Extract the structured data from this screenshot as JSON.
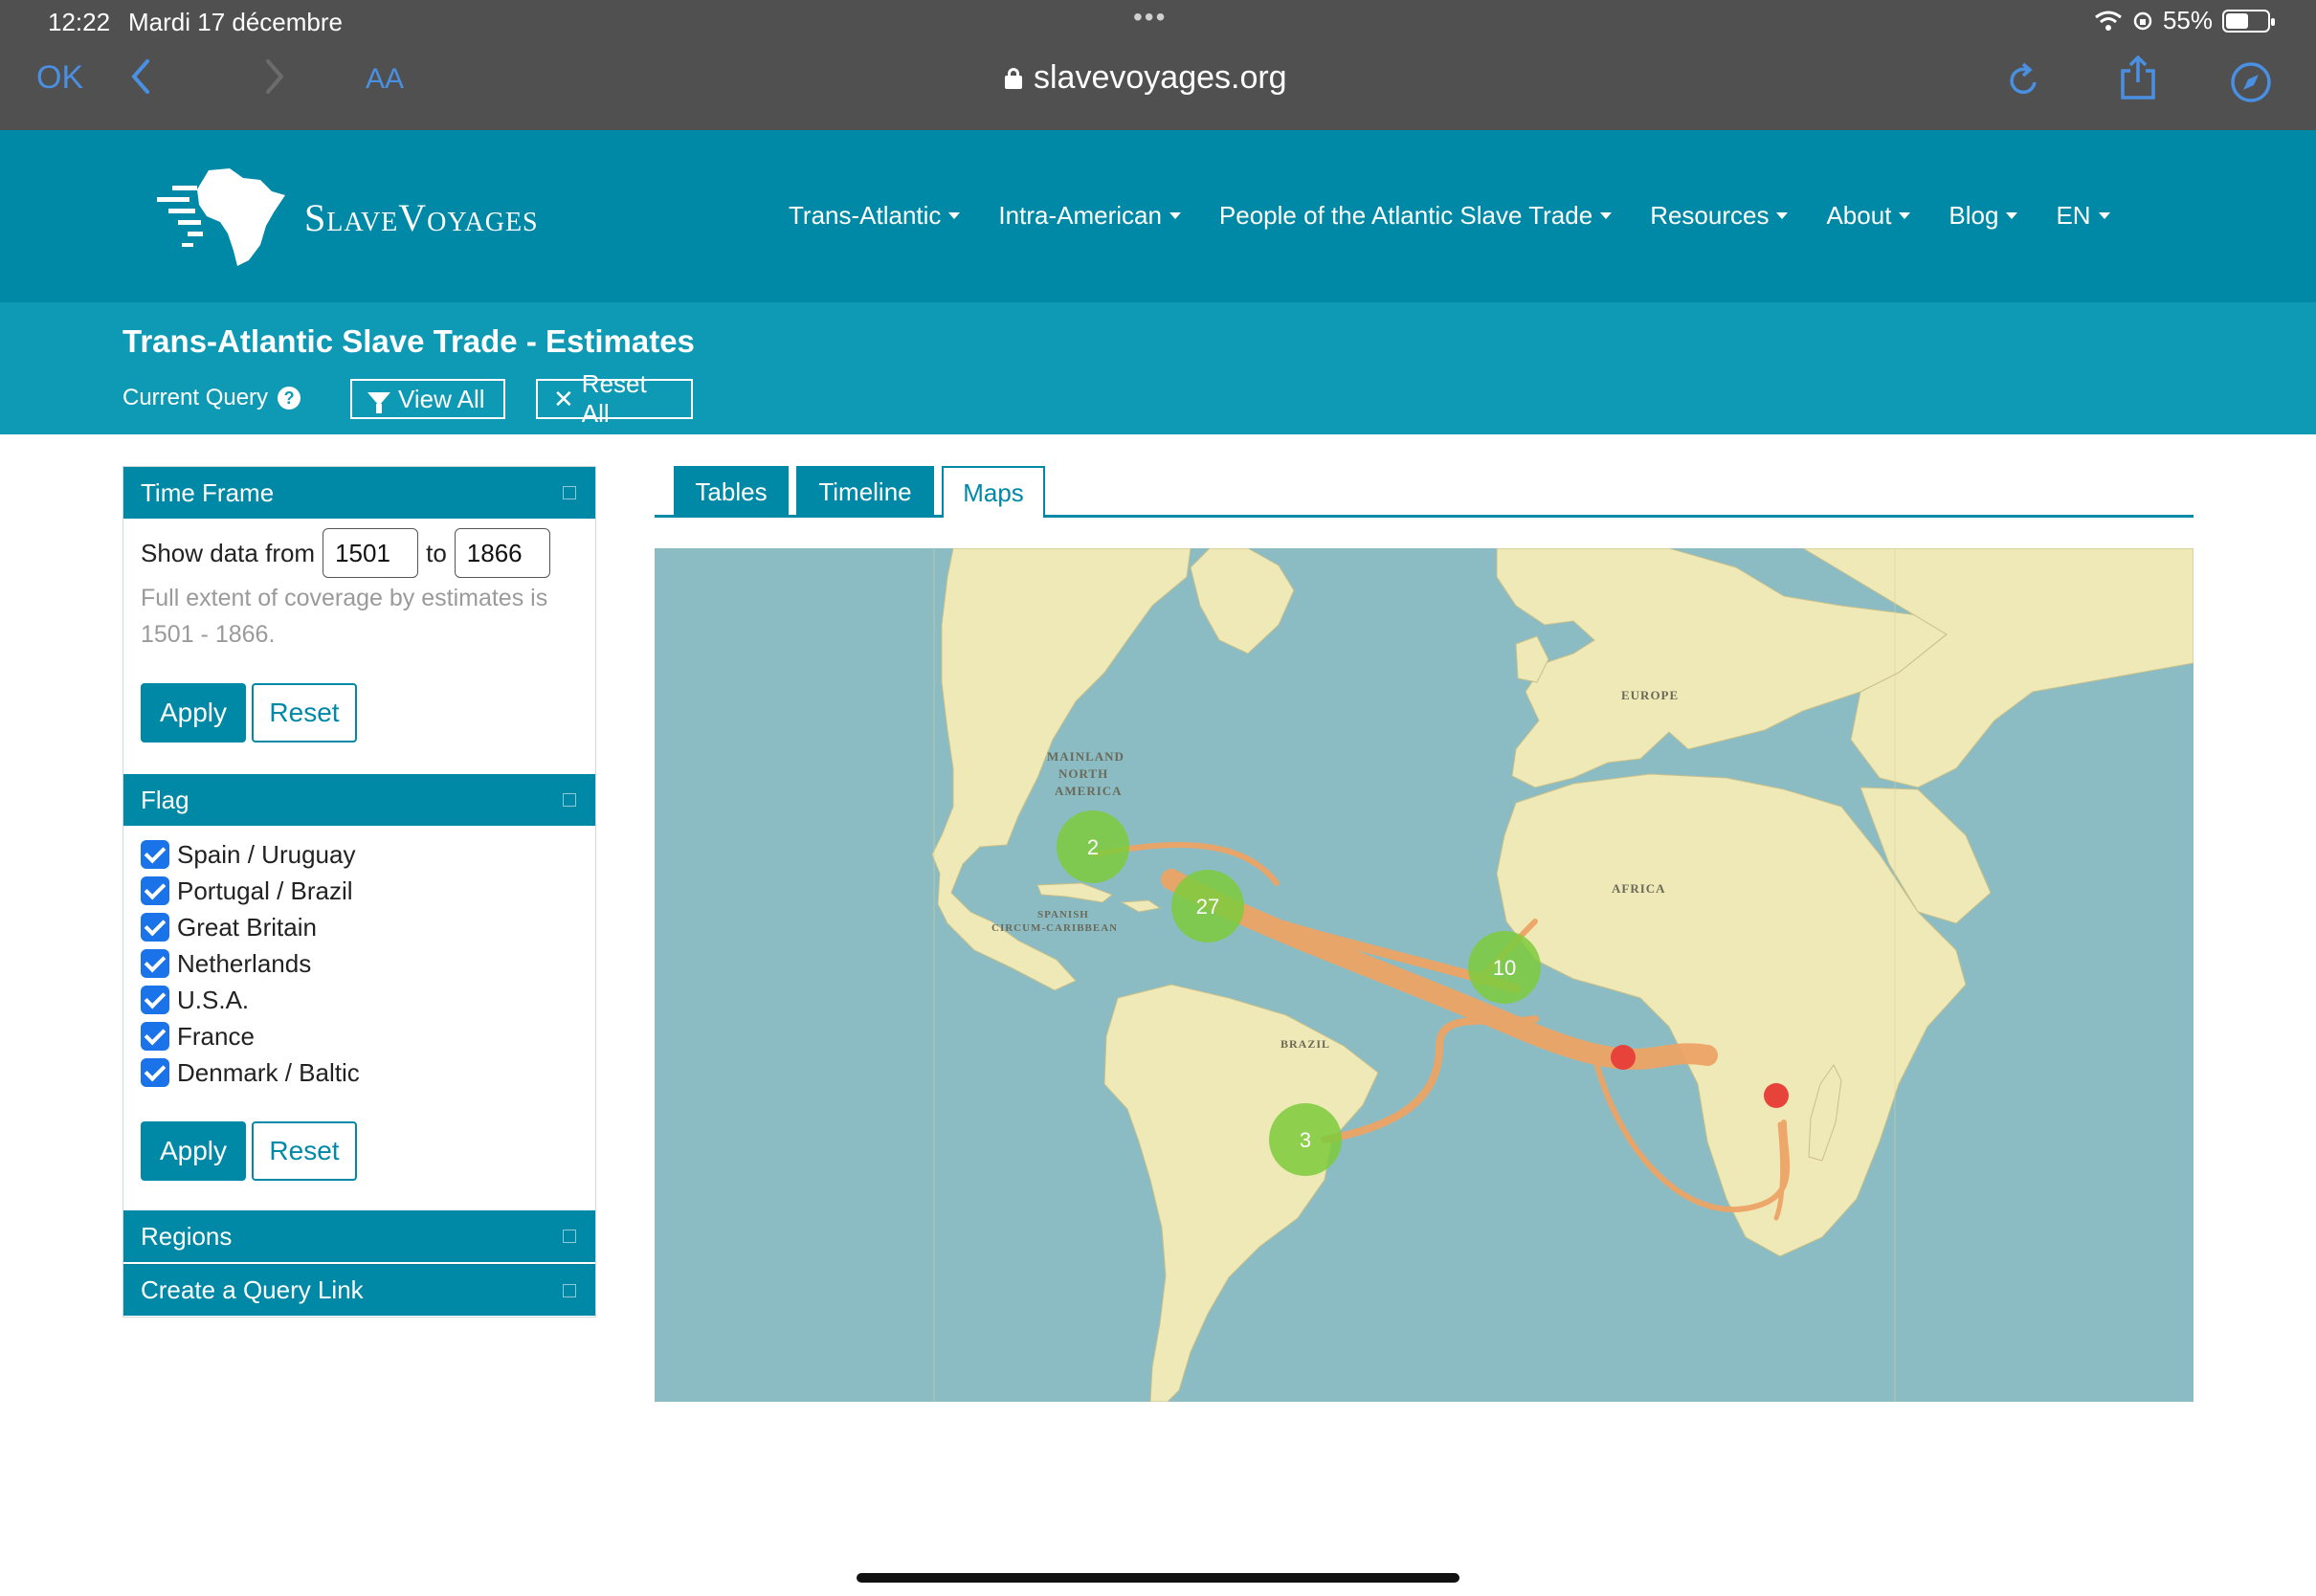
{
  "status_bar": {
    "time": "12:22",
    "date": "Mardi 17 décembre",
    "battery_percent": "55%",
    "battery_level": 0.55
  },
  "browser": {
    "done_label": "OK",
    "text_size_label": "AA",
    "url": "slavevoyages.org"
  },
  "site": {
    "logo_text": "SlaveVoyages",
    "nav": [
      {
        "label": "Trans-Atlantic"
      },
      {
        "label": "Intra-American"
      },
      {
        "label": "People of the Atlantic Slave Trade"
      },
      {
        "label": "Resources"
      },
      {
        "label": "About"
      },
      {
        "label": "Blog"
      },
      {
        "label": "EN"
      }
    ]
  },
  "subheader": {
    "title": "Trans-Atlantic Slave Trade - Estimates",
    "current_query_label": "Current Query",
    "help_icon": "?",
    "view_all_label": "View All",
    "reset_all_label": "Reset All"
  },
  "sidebar": {
    "time_frame": {
      "title": "Time Frame",
      "show_from_label": "Show data from",
      "from_value": "1501",
      "to_label": "to",
      "to_value": "1866",
      "note": "Full extent of coverage by estimates is 1501 - 1866.",
      "apply_label": "Apply",
      "reset_label": "Reset"
    },
    "flag": {
      "title": "Flag",
      "items": [
        {
          "label": "Spain / Uruguay",
          "checked": true
        },
        {
          "label": "Portugal / Brazil",
          "checked": true
        },
        {
          "label": "Great Britain",
          "checked": true
        },
        {
          "label": "Netherlands",
          "checked": true
        },
        {
          "label": "U.S.A.",
          "checked": true
        },
        {
          "label": "France",
          "checked": true
        },
        {
          "label": "Denmark / Baltic",
          "checked": true
        }
      ],
      "apply_label": "Apply",
      "reset_label": "Reset"
    },
    "regions_title": "Regions",
    "query_link_title": "Create a Query Link"
  },
  "tabs": [
    {
      "label": "Tables",
      "active": false
    },
    {
      "label": "Timeline",
      "active": false
    },
    {
      "label": "Maps",
      "active": true
    }
  ],
  "map": {
    "labels": {
      "europe": "EUROPE",
      "africa": "AFRICA",
      "na_1": "MAINLAND",
      "na_2": "NORTH",
      "na_3": "AMERICA",
      "sc_1": "SPANISH",
      "sc_2": "CIRCUM-CARIBBEAN",
      "brazil": "BRAZIL"
    },
    "clusters": [
      {
        "count": "2"
      },
      {
        "count": "27"
      },
      {
        "count": "10"
      },
      {
        "count": "3"
      }
    ],
    "colors": {
      "ocean": "#8bbcc4",
      "land": "#efe9b7",
      "route": "#eea466",
      "cluster": "#7dcb3c",
      "port": "#e8433a"
    }
  },
  "colors": {
    "primary": "#0089a7",
    "subheader": "#0e9ab4",
    "browser_bar": "#505050",
    "ios_blue": "#4a90e2"
  }
}
